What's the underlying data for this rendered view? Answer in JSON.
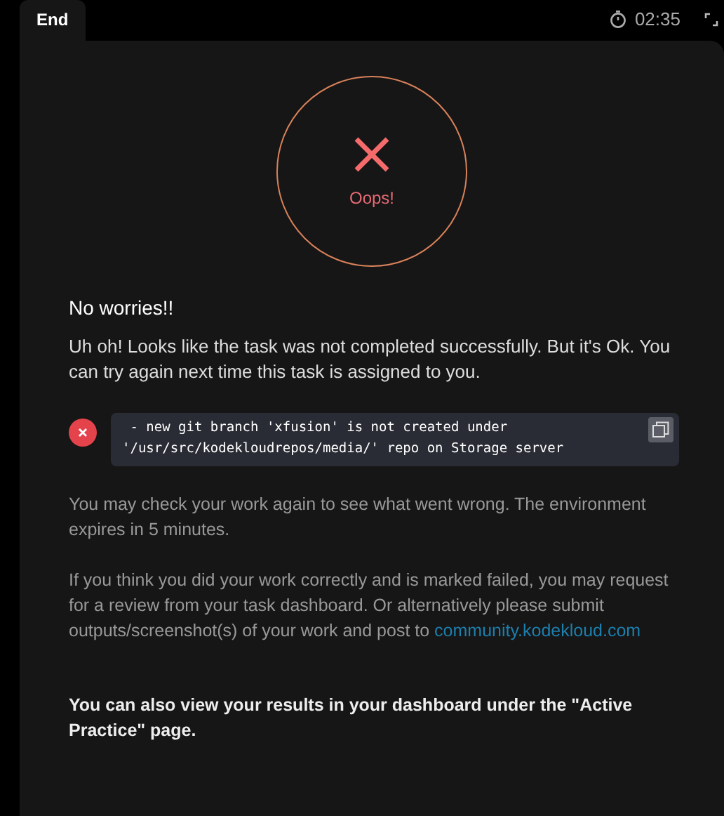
{
  "tab": {
    "label": "End"
  },
  "timer": {
    "time": "02:35"
  },
  "result": {
    "label": "Oops!"
  },
  "heading": "No worries!!",
  "intro": "Uh oh! Looks like the task was not completed successfully. But it's Ok. You can try again next time this task is assigned to you.",
  "errors": [
    {
      "line1": " - new git branch 'xfusion' is not created under",
      "line2": "'/usr/src/kodekloudrepos/media/' repo on Storage server"
    }
  ],
  "check_note": "You may check your work again to see what went wrong. The environment expires in 5 minutes.",
  "review_note": {
    "text": "If you think you did your work correctly and is marked failed, you may request for a review from your task dashboard. Or alternatively please submit outputs/screenshot(s) of your work and post to ",
    "link": "community.kodekloud.com"
  },
  "footer": "You can also view your results in your dashboard under the \"Active Practice\" page."
}
